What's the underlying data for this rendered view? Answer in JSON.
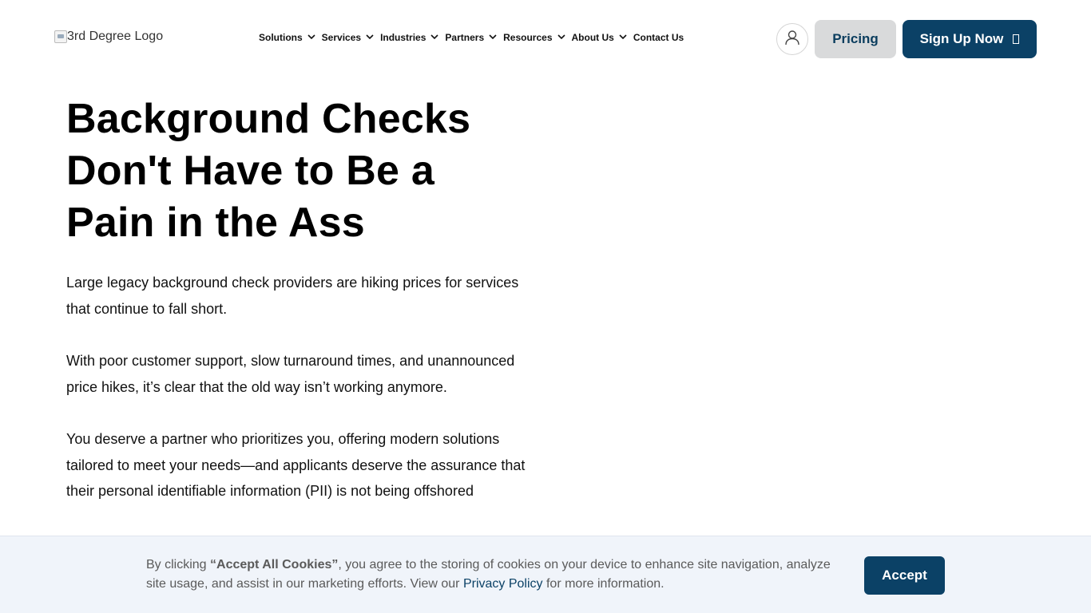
{
  "header": {
    "logo_alt": "3rd Degree Logo",
    "nav": [
      {
        "label": "Solutions",
        "has_dropdown": true
      },
      {
        "label": "Services",
        "has_dropdown": true
      },
      {
        "label": "Industries",
        "has_dropdown": true
      },
      {
        "label": "Partners",
        "has_dropdown": true
      },
      {
        "label": "Resources",
        "has_dropdown": true
      },
      {
        "label": "About Us",
        "has_dropdown": true
      },
      {
        "label": "Contact Us",
        "has_dropdown": false
      }
    ],
    "pricing_label": "Pricing",
    "signup_label": "Sign Up Now"
  },
  "hero": {
    "title_lines": [
      "Background Checks",
      "Don't Have to Be a",
      "Pain in the Ass"
    ],
    "paragraphs": [
      "Large legacy background check providers are hiking prices for services that continue to fall short.",
      "With poor customer support, slow turnaround times, and unannounced price hikes, it’s clear that the old way isn’t working anymore.",
      "You deserve a partner who prioritizes you, offering modern solutions tailored to meet your needs—and applicants deserve the assurance that their personal identifiable information (PII) is not being offshored"
    ]
  },
  "cookie_banner": {
    "text_before": "By clicking ",
    "strong_text": "“Accept All Cookies”",
    "text_middle": ", you agree to the storing of cookies on your device to enhance site navigation, analyze site usage, and assist in our marketing efforts. View our ",
    "link_text": "Privacy Policy",
    "text_after": " for more information.",
    "accept_label": "Accept"
  },
  "colors": {
    "brand_navy": "#0b4166",
    "pricing_bg": "#d9dadb",
    "banner_bg": "#f0f4fa"
  }
}
